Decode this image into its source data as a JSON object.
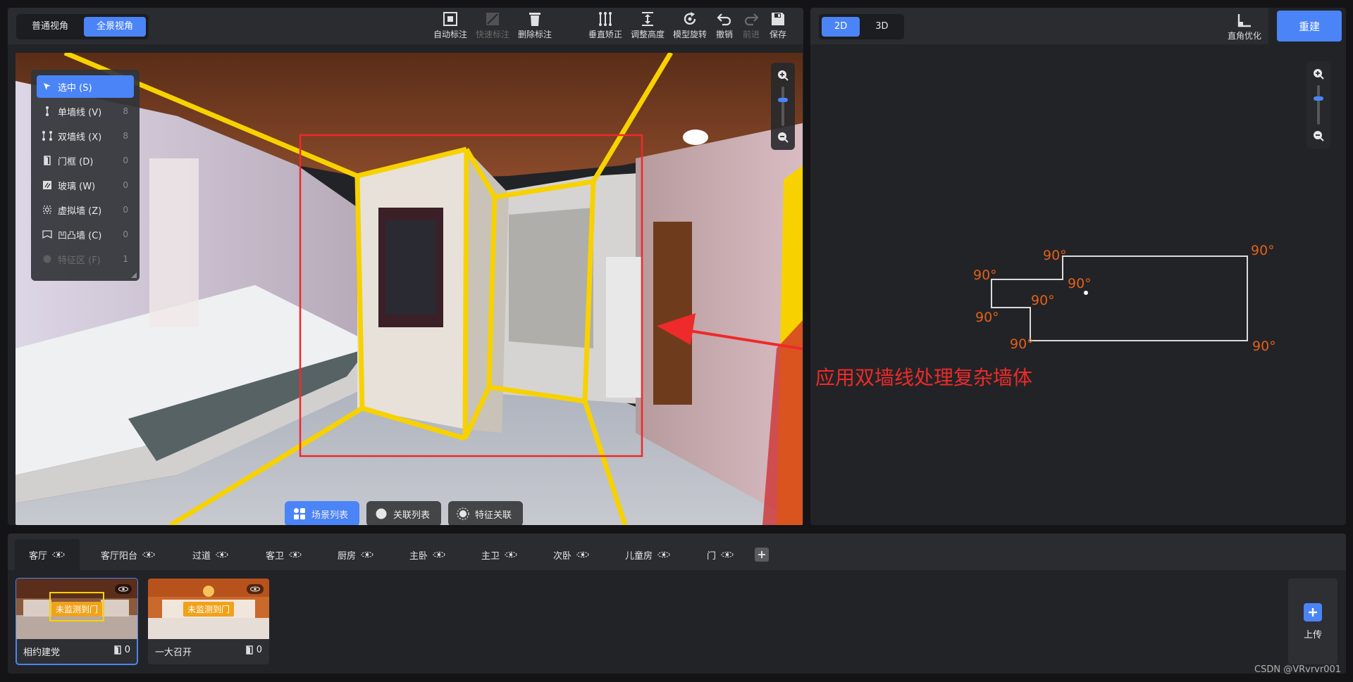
{
  "view_modes": [
    {
      "label": "普通视角",
      "active": false
    },
    {
      "label": "全景视角",
      "active": true
    }
  ],
  "toolbar": [
    {
      "label": "自动标注",
      "icon": "auto-annotate-icon",
      "disabled": false
    },
    {
      "label": "快速标注",
      "icon": "quick-annotate-icon",
      "disabled": true
    },
    {
      "label": "删除标注",
      "icon": "trash-icon",
      "disabled": false
    },
    {
      "label": "垂直矫正",
      "icon": "vertical-correct-icon",
      "disabled": false
    },
    {
      "label": "调整高度",
      "icon": "height-adjust-icon",
      "disabled": false
    },
    {
      "label": "模型旋转",
      "icon": "rotate-icon",
      "disabled": false
    },
    {
      "label": "撤销",
      "icon": "undo-icon",
      "disabled": false
    },
    {
      "label": "前进",
      "icon": "redo-icon",
      "disabled": true
    },
    {
      "label": "保存",
      "icon": "save-icon",
      "disabled": false
    }
  ],
  "draw_modes": [
    {
      "label": "选中 (S)",
      "count": "",
      "icon": "pointer-icon",
      "active": true
    },
    {
      "label": "单墙线 (V)",
      "count": "8",
      "icon": "single-wall-icon",
      "active": false
    },
    {
      "label": "双墙线 (X)",
      "count": "8",
      "icon": "double-wall-icon",
      "active": false
    },
    {
      "label": "门框 (D)",
      "count": "0",
      "icon": "door-frame-icon",
      "active": false
    },
    {
      "label": "玻璃 (W)",
      "count": "0",
      "icon": "glass-icon",
      "active": false
    },
    {
      "label": "虚拟墙 (Z)",
      "count": "0",
      "icon": "virtual-wall-icon",
      "active": false
    },
    {
      "label": "凹凸墙 (C)",
      "count": "0",
      "icon": "bump-wall-icon",
      "active": false
    },
    {
      "label": "特征区 (F)",
      "count": "1",
      "icon": "feature-zone-icon",
      "active": false,
      "disabled": true
    }
  ],
  "scene_tabs": [
    {
      "label": "场景列表",
      "icon": "scene-list-icon",
      "active": true
    },
    {
      "label": "关联列表",
      "icon": "link-list-icon",
      "active": false
    },
    {
      "label": "特征关联",
      "icon": "feature-link-icon",
      "active": false
    }
  ],
  "dim_modes": [
    {
      "label": "2D",
      "active": true
    },
    {
      "label": "3D",
      "active": false
    }
  ],
  "right_tool": {
    "label": "直角优化",
    "icon": "right-angle-icon"
  },
  "rebuild_label": "重建",
  "annotation": "应用双墙线处理复杂墙体",
  "angles": [
    "90°",
    "90°",
    "90°",
    "90°",
    "90°",
    "90°",
    "90°",
    "90°"
  ],
  "rooms": [
    {
      "label": "客厅",
      "active": true
    },
    {
      "label": "客厅阳台",
      "active": false
    },
    {
      "label": "过道",
      "active": false
    },
    {
      "label": "客卫",
      "active": false
    },
    {
      "label": "厨房",
      "active": false
    },
    {
      "label": "主卧",
      "active": false
    },
    {
      "label": "主卫",
      "active": false
    },
    {
      "label": "次卧",
      "active": false
    },
    {
      "label": "儿童房",
      "active": false
    },
    {
      "label": "门",
      "active": false
    }
  ],
  "thumbnails": [
    {
      "name": "相约建党",
      "badge": "未监测到门",
      "count": "0",
      "active": true
    },
    {
      "name": "一大召开",
      "badge": "未监测到门",
      "count": "0",
      "active": false
    }
  ],
  "upload_label": "上传",
  "watermark": "CSDN @VRvrvr001",
  "colors": {
    "accent": "#4a84f7",
    "annotation": "#ee2a2a",
    "angle": "#e0601c",
    "wall_line": "#f7d200"
  }
}
